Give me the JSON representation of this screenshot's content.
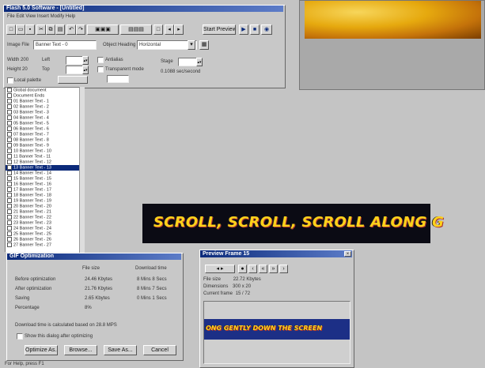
{
  "main_window": {
    "title": "Flash 5.0 Software - [Untitled]",
    "menu": "File  Edit  View  Insert  Modify  Help",
    "toolbar_buttons": [
      "New",
      "Open",
      "Save",
      "Cut",
      "Copy",
      "Paste",
      "Undo",
      "Redo",
      "Fit",
      "Zoom",
      "Play",
      "Stop",
      "Start Preview"
    ],
    "image_file_label": "Image File",
    "image_file_value": "Banner Text - 0",
    "object_label": "Object Heading",
    "object_value": "Horizontal",
    "width_label": "Width",
    "width_value": "200",
    "height_label": "Height",
    "height_value": "20",
    "left_label": "Left",
    "top_label": "Top",
    "antialias_label": "Antialias",
    "transparent_label": "Transparent mode",
    "stage_label": "Stage",
    "rate_text": "0.1088 sec/second",
    "local_palette_label": "Local palette"
  },
  "frame_list": {
    "items": [
      "Global document",
      "Document Ends",
      "01 Banner Text - 1",
      "02 Banner Text - 2",
      "03 Banner Text - 3",
      "04 Banner Text - 4",
      "05 Banner Text - 5",
      "06 Banner Text - 6",
      "07 Banner Text - 7",
      "08 Banner Text - 8",
      "09 Banner Text - 9",
      "10 Banner Text - 10",
      "11 Banner Text - 11",
      "12 Banner Text - 12",
      "13 Banner Text - 13",
      "14 Banner Text - 14",
      "15 Banner Text - 15",
      "16 Banner Text - 16",
      "17 Banner Text - 17",
      "18 Banner Text - 18",
      "19 Banner Text - 19",
      "20 Banner Text - 20",
      "21 Banner Text - 21",
      "22 Banner Text - 22",
      "23 Banner Text - 23",
      "24 Banner Text - 24",
      "25 Banner Text - 25",
      "26 Banner Text - 26",
      "27 Banner Text - 27"
    ],
    "selected_index": 14
  },
  "canvas_banner": {
    "text": "SCROLL, SCROLL, SCROLL ALONG G"
  },
  "optimize_dialog": {
    "title": "GIF Optimization",
    "col_headers": [
      "File size",
      "Download time"
    ],
    "rows": [
      {
        "label": "Before optimization",
        "size": "24.46 Kbytes",
        "time": "8 Mins 8 Secs"
      },
      {
        "label": "After optimization",
        "size": "21.76 Kbytes",
        "time": "8 Mins 7 Secs"
      },
      {
        "label": "Saving",
        "size": "2.65 Kbytes",
        "time": "0 Mins 1 Secs"
      },
      {
        "label": "Percentage",
        "size": "8%",
        "time": ""
      }
    ],
    "note": "Download time is calculated based on 28.8 MPS",
    "checkbox_label": "Show this dialog after optimizing",
    "buttons": [
      "Optimize As...",
      "Browse...",
      "Save As...",
      "Cancel"
    ]
  },
  "preview_window": {
    "title": "Preview Frame 15",
    "stats": [
      {
        "label": "File size",
        "value": "22.72 Kbytes"
      },
      {
        "label": "Dimensions",
        "value": "300 x 20"
      },
      {
        "label": "Current frame",
        "value": "15 / 72"
      }
    ],
    "banner_text": "ONG GENTLY DOWN THE SCREEN"
  },
  "status_bar": {
    "text": "For Help, press F1"
  },
  "colors": {
    "banner_bg": "#0b0b14",
    "banner_text": "#ffd21a",
    "preview_banner_bg": "#1c2f86",
    "titlebar": "#0b2a7a",
    "selection": "#0b2a7a"
  }
}
